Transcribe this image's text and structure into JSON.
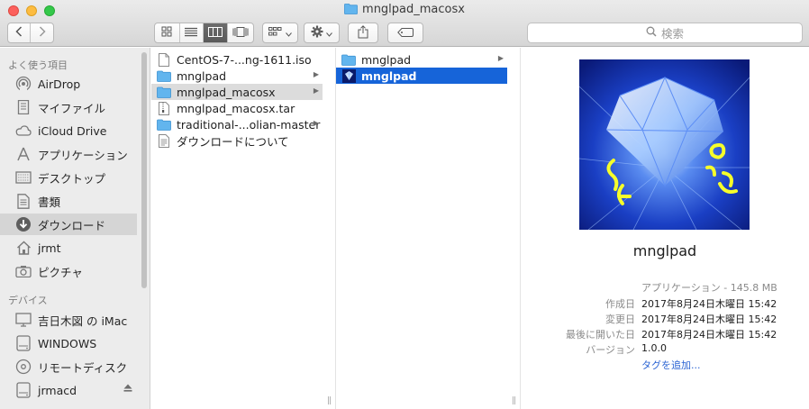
{
  "window": {
    "title": "mnglpad_macosx"
  },
  "toolbar": {
    "back_icon": "chevron-left-icon",
    "forward_icon": "chevron-right-icon",
    "view_icons": [
      "icon-view-icon",
      "list-view-icon",
      "column-view-icon",
      "cover-flow-icon"
    ],
    "active_view": "column",
    "search_placeholder": "検索"
  },
  "sidebar": {
    "favorites_header": "よく使う項目",
    "favorites": [
      {
        "label": "AirDrop",
        "icon": "airdrop-icon"
      },
      {
        "label": "マイファイル",
        "icon": "all-files-icon"
      },
      {
        "label": "iCloud Drive",
        "icon": "cloud-icon"
      },
      {
        "label": "アプリケーション",
        "icon": "applications-icon"
      },
      {
        "label": "デスクトップ",
        "icon": "desktop-icon"
      },
      {
        "label": "書類",
        "icon": "documents-icon"
      },
      {
        "label": "ダウンロード",
        "icon": "downloads-icon",
        "selected": true
      },
      {
        "label": "jrmt",
        "icon": "home-icon"
      },
      {
        "label": "ピクチャ",
        "icon": "camera-icon"
      }
    ],
    "devices_header": "デバイス",
    "devices": [
      {
        "label": "吉日木図 の iMac",
        "icon": "computer-icon"
      },
      {
        "label": "WINDOWS",
        "icon": "disk-icon"
      },
      {
        "label": "リモートディスク",
        "icon": "remote-disc-icon"
      },
      {
        "label": "jrmacd",
        "icon": "disk-icon",
        "eject": true
      }
    ]
  },
  "column1": {
    "items": [
      {
        "label": "CentOS-7-...ng-1611.iso",
        "icon": "file-icon",
        "has_children": false
      },
      {
        "label": "mnglpad",
        "icon": "folder-icon",
        "has_children": true
      },
      {
        "label": "mnglpad_macosx",
        "icon": "folder-icon",
        "has_children": true,
        "selected": true
      },
      {
        "label": "mnglpad_macosx.tar",
        "icon": "archive-icon",
        "has_children": false
      },
      {
        "label": "traditional-...olian-master",
        "icon": "folder-icon",
        "has_children": true
      },
      {
        "label": "ダウンロードについて",
        "icon": "document-icon",
        "has_children": false
      }
    ]
  },
  "column2": {
    "items": [
      {
        "label": "mnglpad",
        "icon": "folder-icon",
        "has_children": true
      },
      {
        "label": "mnglpad",
        "icon": "app-icon",
        "has_children": false,
        "selected": true
      }
    ]
  },
  "preview": {
    "name": "mnglpad",
    "kind": "アプリケーション - 145.8 MB",
    "fields": [
      {
        "key": "作成日",
        "value": "2017年8月24日木曜日 15:42"
      },
      {
        "key": "変更日",
        "value": "2017年8月24日木曜日 15:42"
      },
      {
        "key": "最後に開いた日",
        "value": "2017年8月24日木曜日 15:42"
      },
      {
        "key": "バージョン",
        "value": "1.0.0"
      }
    ],
    "add_tags": "タグを追加..."
  },
  "colors": {
    "selection_blue": "#1664d9",
    "folder_blue": "#5fb3ec",
    "link_blue": "#2b64d3"
  }
}
